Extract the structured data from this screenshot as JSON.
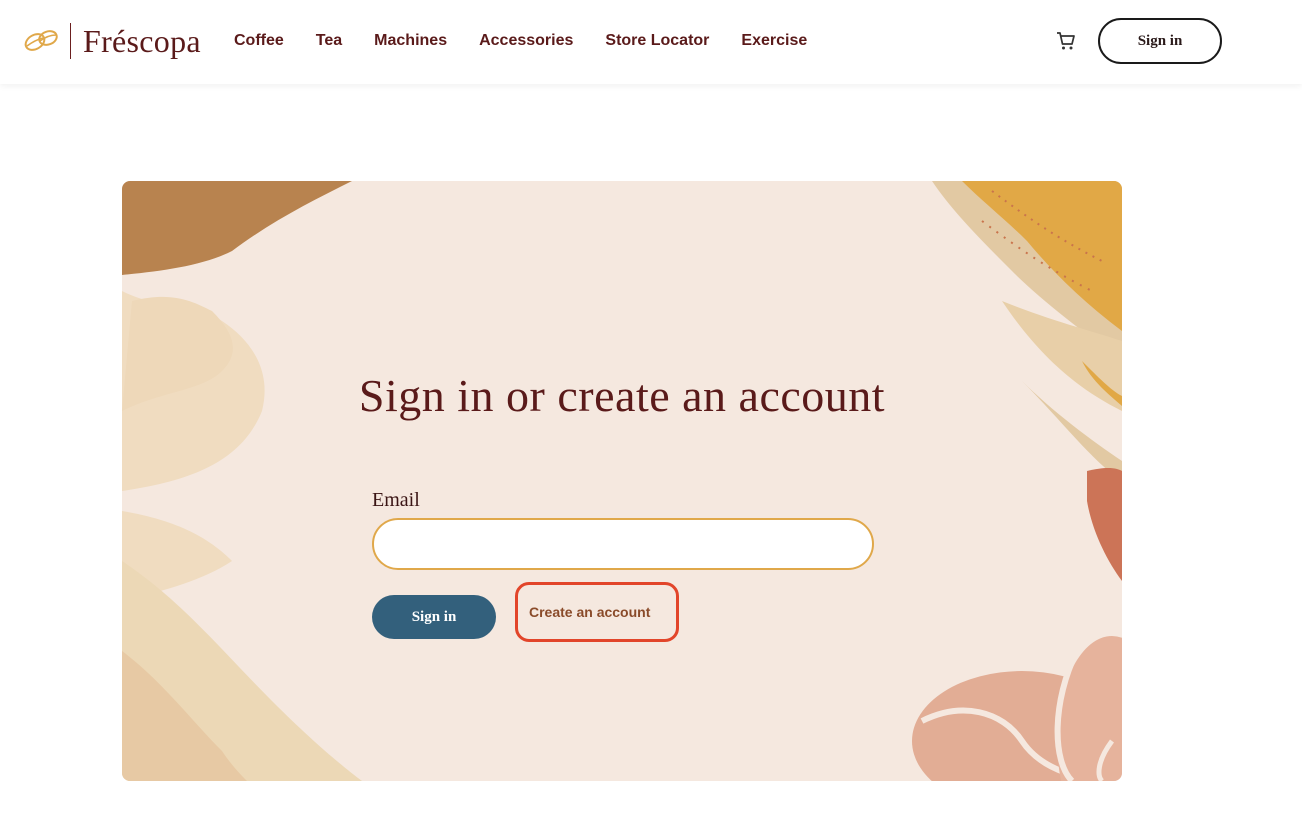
{
  "brand": {
    "name": "Fréscopa",
    "accent": "#e0a84a",
    "primary": "#5a1a1a"
  },
  "nav": {
    "items": [
      {
        "label": "Coffee"
      },
      {
        "label": "Tea"
      },
      {
        "label": "Machines"
      },
      {
        "label": "Accessories"
      },
      {
        "label": "Store Locator"
      },
      {
        "label": "Exercise"
      }
    ]
  },
  "header": {
    "cart_icon": "cart-icon",
    "signin_label": "Sign in"
  },
  "main": {
    "title": "Sign in or create an account",
    "email_label": "Email",
    "email_value": "",
    "email_placeholder": "",
    "signin_label": "Sign in",
    "create_label": "Create an account",
    "colors": {
      "signin_bg": "#33607c",
      "highlight": "#e2452a",
      "card_bg": "#f5e8df"
    }
  }
}
